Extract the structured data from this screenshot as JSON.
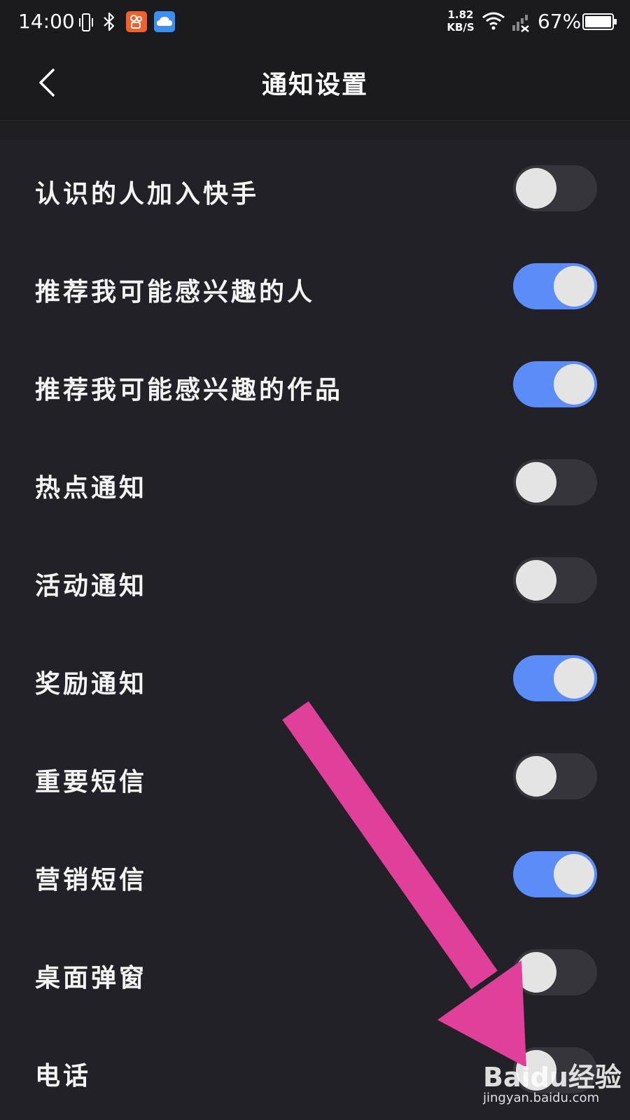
{
  "status_bar": {
    "time": "14:00",
    "net_speed_value": "1.82",
    "net_speed_unit": "KB/S",
    "battery_percent": "67%",
    "icons": [
      "vibrate-icon",
      "bluetooth-icon",
      "kuaishou-app-icon",
      "cloud-app-icon",
      "wifi-icon",
      "signal-icon",
      "battery-icon"
    ]
  },
  "header": {
    "title": "通知设置",
    "back_icon": "chevron-left-icon"
  },
  "settings": [
    {
      "label": "认识的人加入快手",
      "on": false
    },
    {
      "label": "推荐我可能感兴趣的人",
      "on": true
    },
    {
      "label": "推荐我可能感兴趣的作品",
      "on": true
    },
    {
      "label": "热点通知",
      "on": false
    },
    {
      "label": "活动通知",
      "on": false
    },
    {
      "label": "奖励通知",
      "on": true
    },
    {
      "label": "重要短信",
      "on": false
    },
    {
      "label": "营销短信",
      "on": true
    },
    {
      "label": "桌面弹窗",
      "on": false
    },
    {
      "label": "电话",
      "on": false
    }
  ],
  "watermark": {
    "brand": "Baidu经验",
    "url": "jingyan.baidu.com"
  },
  "colors": {
    "background": "#222127",
    "toggle_on": "#5b8cf7",
    "toggle_off": "#36353b",
    "knob": "#e4e4e4",
    "annotation_arrow": "#e0409a"
  }
}
